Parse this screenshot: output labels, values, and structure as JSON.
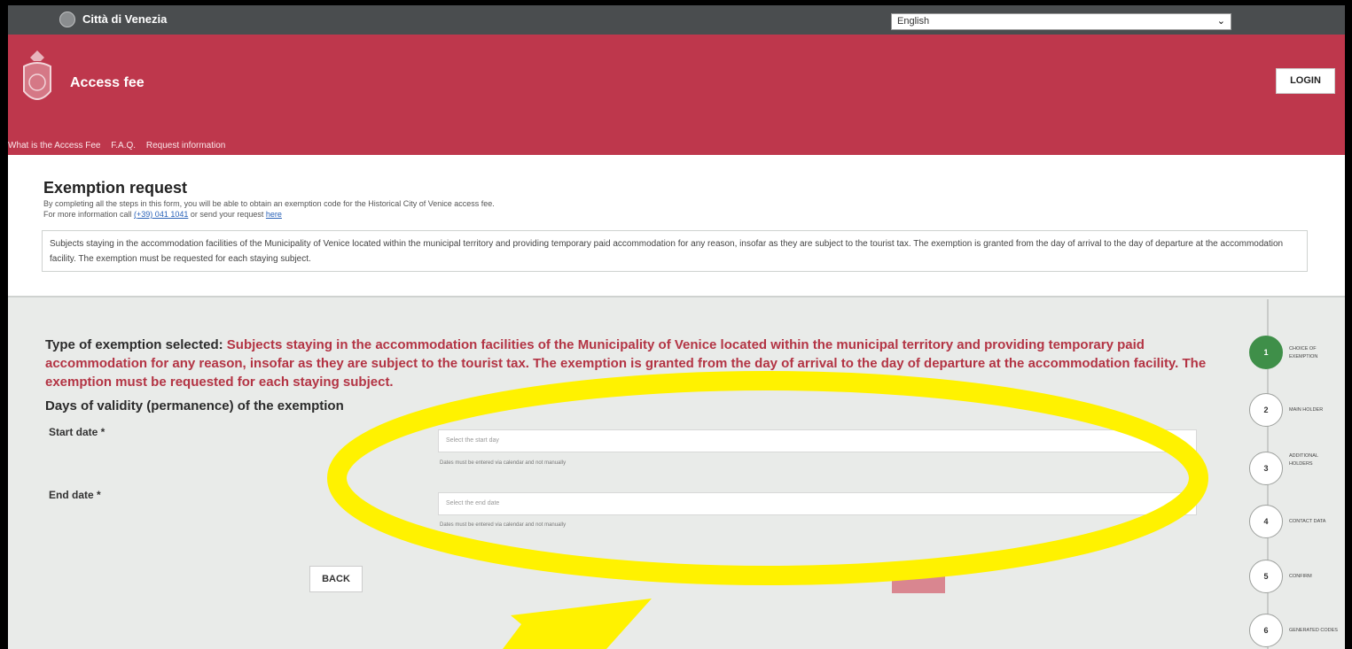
{
  "topbar": {
    "city": "Città di Venezia",
    "language_selected": "English"
  },
  "header": {
    "title": "Access fee",
    "login_label": "LOGIN",
    "nav": [
      "What is the Access Fee",
      "F.A.Q.",
      "Request information"
    ]
  },
  "intro": {
    "heading": "Exemption request",
    "line1": "By completing all the steps in this form, you will be able to obtain an exemption code for the Historical City of Venice access fee.",
    "line2_prefix": "For more information call ",
    "phone": "(+39) 041 1041",
    "line2_mid": " or send your request ",
    "here_link": "here",
    "info_text": "Subjects staying in the accommodation facilities of the Municipality of Venice located within the municipal territory and providing temporary paid accommodation for any reason, insofar as they are subject to the tourist tax. The exemption is granted from the day of arrival to the day of departure at the accommodation facility. The exemption must be requested for each staying subject."
  },
  "form": {
    "type_label": "Type of exemption selected: ",
    "type_value": "Subjects staying in the accommodation facilities of the Municipality of Venice located within the municipal territory and providing temporary paid accommodation for any reason, insofar as they are subject to the tourist tax. The exemption is granted from the day of arrival to the day of departure at the accommodation facility. The exemption must be requested for each staying subject.",
    "days_title": "Days of validity (permanence) of the exemption",
    "start_label": "Start date *",
    "start_placeholder": "Select the start day",
    "start_hint": "Dates must be entered via calendar and not manually",
    "end_label": "End date *",
    "end_placeholder": "Select the end date",
    "end_hint": "Dates must be entered via calendar and not manually",
    "back_label": "BACK"
  },
  "steps": [
    {
      "num": "1",
      "label": "Choice of exemption",
      "active": true
    },
    {
      "num": "2",
      "label": "Main holder",
      "active": false
    },
    {
      "num": "3",
      "label": "Additional holders",
      "active": false
    },
    {
      "num": "4",
      "label": "Contact data",
      "active": false
    },
    {
      "num": "5",
      "label": "Confirm",
      "active": false
    },
    {
      "num": "6",
      "label": "Generated codes",
      "active": false
    }
  ],
  "colors": {
    "header_red": "#be374c",
    "type_value_red": "#b33444",
    "active_step_green": "#3f8f49",
    "annotation_yellow": "#fff200"
  }
}
